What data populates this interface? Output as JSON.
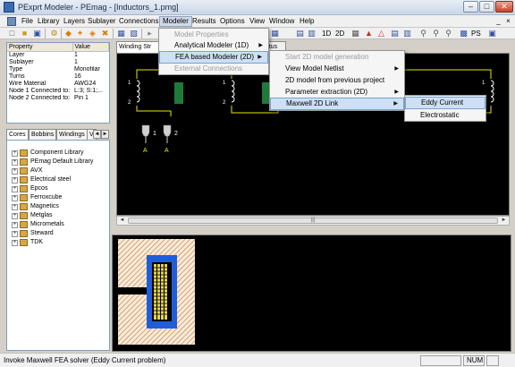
{
  "window": {
    "title": "PExprt Modeler - PEmag - [Inductors_1.pmg]",
    "min": "–",
    "max": "□",
    "close": "✕"
  },
  "menubar": {
    "items": [
      "File",
      "Library",
      "Layers",
      "Sublayer",
      "Connections",
      "Modeler",
      "Results",
      "Options",
      "View",
      "Window",
      "Help"
    ],
    "mdi": [
      "_",
      "×"
    ]
  },
  "toolbar": {
    "text_1d": "1D",
    "text_2d": "2D",
    "text_ps": "PS"
  },
  "properties": {
    "headers": [
      "Property",
      "Value"
    ],
    "rows": [
      [
        "Layer",
        "1"
      ],
      [
        "Sublayer",
        "1"
      ],
      [
        "Type",
        "Monofilar"
      ],
      [
        "Turns",
        "16"
      ],
      [
        "Wire Material",
        "AWG24"
      ],
      [
        "Node 1 Connected to:",
        "L:3; S:1;..."
      ],
      [
        "Node 2 Connected to:",
        "Pin 1"
      ]
    ]
  },
  "library": {
    "tabs": [
      "Cores",
      "Bobbins",
      "Windings",
      "V"
    ],
    "tree": [
      "Component Library",
      "PEmag Default Library",
      "AVX",
      "Electrical steel",
      "Epcos",
      "Ferroxcube",
      "Magnetics",
      "Metglas",
      "Micrometals",
      "Steward",
      "TDK"
    ]
  },
  "document": {
    "tab1": "Winding Str",
    "tab2": "tatus"
  },
  "schematic": {
    "pin_labels": [
      "1",
      "2"
    ],
    "pin_letters": [
      "A",
      "A"
    ],
    "node_labels": [
      "1",
      "2",
      "1",
      "2",
      "1",
      "2"
    ],
    "colors": {
      "background": "#000000",
      "wire": "#e8e800",
      "coil": "#ffffff",
      "core": "#1f7a3a"
    }
  },
  "fea": {
    "colors": {
      "hatch": "#c96b3c",
      "bobbin": "#1e5fd8",
      "winding": "#e6d44b",
      "core_bg": "#f6ecd8"
    }
  },
  "menus": {
    "modeler": [
      {
        "label": "Model Properties",
        "disabled": true
      },
      {
        "label": "Analytical Modeler (1D)",
        "submenu": true
      },
      {
        "label": "FEA based Modeler (2D)",
        "submenu": true,
        "highlighted": true
      },
      {
        "label": "External Connections",
        "disabled": true
      }
    ],
    "fea": [
      {
        "label": "Start 2D model generation",
        "disabled": true
      },
      {
        "label": "View Model Netlist",
        "submenu": true
      },
      {
        "label": "2D model from previous project"
      },
      {
        "label": "Parameter extraction (2D)",
        "submenu": true
      },
      {
        "label": "Maxwell 2D Link",
        "submenu": true,
        "highlighted": true
      }
    ],
    "maxwell": [
      {
        "label": "Eddy Current",
        "highlighted": true
      },
      {
        "label": "Electrostatic"
      }
    ]
  },
  "status": {
    "message": "Invoke Maxwell FEA solver (Eddy Current problem)",
    "num": "NUM"
  },
  "scroll": {
    "left": "◄",
    "right": "►",
    "grip": "|||"
  }
}
